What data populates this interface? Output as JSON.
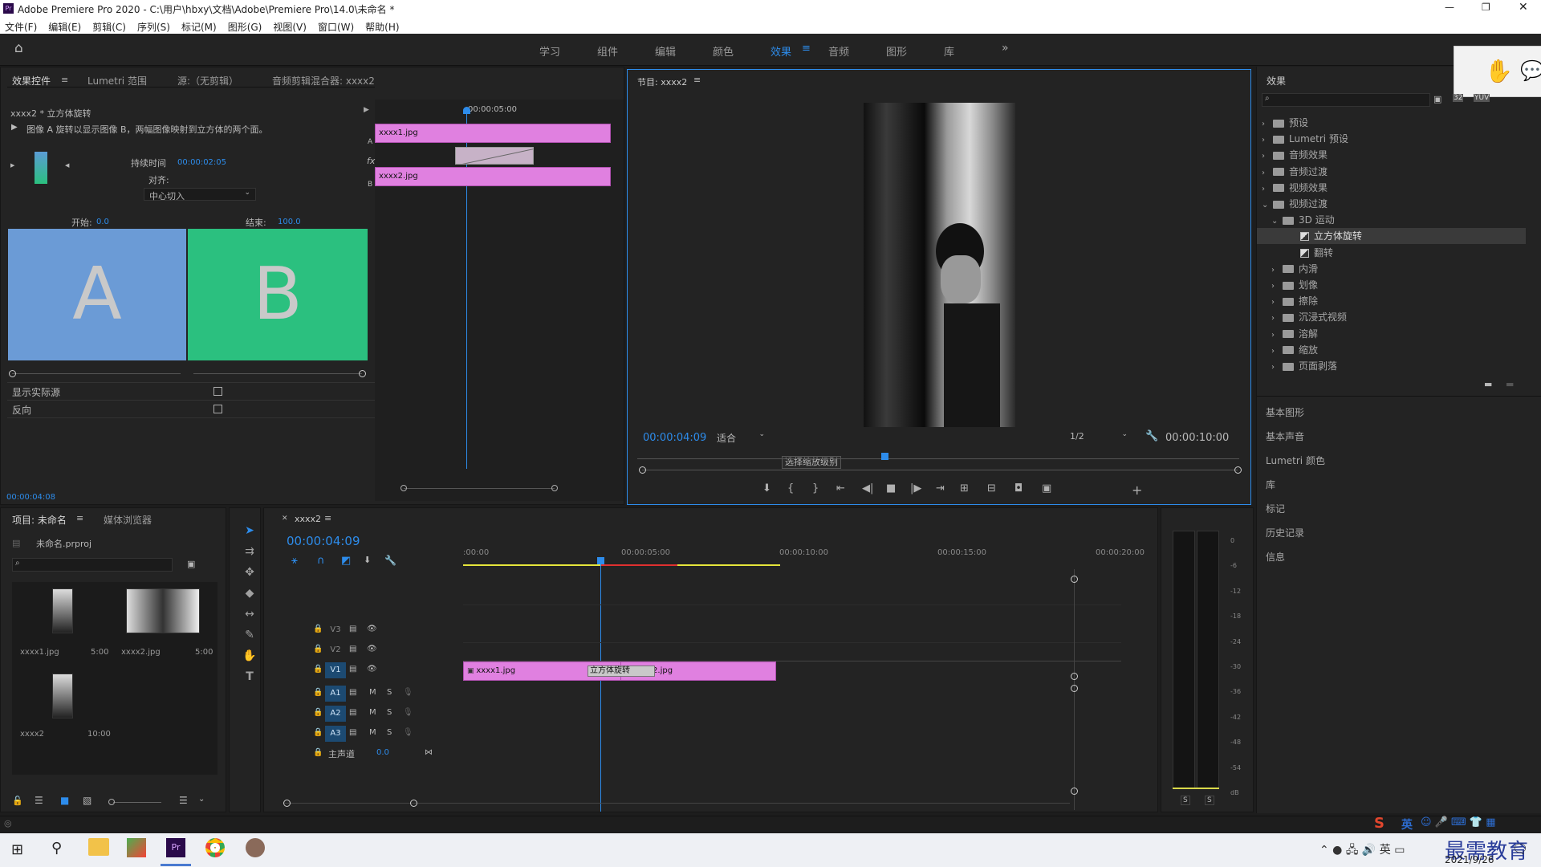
{
  "window": {
    "title": "Adobe Premiere Pro 2020 - C:\\用户\\hbxy\\文档\\Adobe\\Premiere Pro\\14.0\\未命名 *"
  },
  "menu": [
    "文件(F)",
    "编辑(E)",
    "剪辑(C)",
    "序列(S)",
    "标记(M)",
    "图形(G)",
    "视图(V)",
    "窗口(W)",
    "帮助(H)"
  ],
  "workspaces": [
    "学习",
    "组件",
    "编辑",
    "颜色",
    "效果",
    "音频",
    "图形",
    "库"
  ],
  "effect_controls": {
    "tabs": [
      "效果控件",
      "Lumetri 范围",
      "源:（无剪辑）",
      "音频剪辑混合器: xxxx2"
    ],
    "clip_name": "xxxx2 * 立方体旋转",
    "description": "图像 A 旋转以显示图像 B，两幅图像映射到立方体的两个面。",
    "duration_label": "持续时间",
    "duration_value": "00:00:02:05",
    "align_label": "对齐:",
    "align_value": "中心切入",
    "start_label": "开始:",
    "start_value": "0.0",
    "end_label": "结束:",
    "end_value": "100.0",
    "a_label": "A",
    "b_label": "B",
    "show_actual_label": "显示实际源",
    "reverse_label": "反向",
    "timecode": "00:00:04:08",
    "mini_timeline_time": "00:00:05:00",
    "clip_a": "xxxx1.jpg",
    "clip_b": "xxxx2.jpg",
    "track_a": "A",
    "track_b": "B",
    "fx": "fx"
  },
  "program": {
    "title": "节目: xxxx2",
    "timecode": "00:00:04:09",
    "fit": "适合",
    "quality": "1/2",
    "duration": "00:00:10:00",
    "tooltip": "选择缩放级别",
    "playhead_fraction": 0.41
  },
  "effects_panel": {
    "title": "效果",
    "tree": [
      {
        "label": "预设",
        "indent": 0,
        "type": "folder"
      },
      {
        "label": "Lumetri 预设",
        "indent": 0,
        "type": "folder"
      },
      {
        "label": "音频效果",
        "indent": 0,
        "type": "folder"
      },
      {
        "label": "音频过渡",
        "indent": 0,
        "type": "folder"
      },
      {
        "label": "视频效果",
        "indent": 0,
        "type": "folder"
      },
      {
        "label": "视频过渡",
        "indent": 0,
        "type": "folder-open"
      },
      {
        "label": "3D 运动",
        "indent": 1,
        "type": "folder-open"
      },
      {
        "label": "立方体旋转",
        "indent": 2,
        "type": "item",
        "selected": true
      },
      {
        "label": "翻转",
        "indent": 2,
        "type": "item"
      },
      {
        "label": "内滑",
        "indent": 1,
        "type": "folder"
      },
      {
        "label": "划像",
        "indent": 1,
        "type": "folder"
      },
      {
        "label": "擦除",
        "indent": 1,
        "type": "folder"
      },
      {
        "label": "沉浸式视频",
        "indent": 1,
        "type": "folder"
      },
      {
        "label": "溶解",
        "indent": 1,
        "type": "folder"
      },
      {
        "label": "缩放",
        "indent": 1,
        "type": "folder"
      },
      {
        "label": "页面剥落",
        "indent": 1,
        "type": "folder"
      }
    ],
    "collapsed_panels": [
      "基本图形",
      "基本声音",
      "Lumetri 颜色",
      "库",
      "标记",
      "历史记录",
      "信息"
    ]
  },
  "project": {
    "tabs": [
      "项目: 未命名",
      "媒体浏览器"
    ],
    "file": "未命名.prproj",
    "items": [
      {
        "name": "xxxx1.jpg",
        "duration": "5:00"
      },
      {
        "name": "xxxx2.jpg",
        "duration": "5:00"
      },
      {
        "name": "xxxx2",
        "duration": "10:00"
      }
    ]
  },
  "timeline": {
    "sequence": "xxxx2",
    "timecode": "00:00:04:09",
    "ruler": [
      ":00:00",
      "00:00:05:00",
      "00:00:10:00",
      "00:00:15:00",
      "00:00:20:00"
    ],
    "video_tracks": [
      "V3",
      "V2",
      "V1"
    ],
    "audio_tracks": [
      "A1",
      "A2",
      "A3"
    ],
    "master_label": "主声道",
    "master_value": "0.0",
    "clip1": "xxxx1.jpg",
    "clip2": "xxxx2.jpg",
    "transition": "立方体旋转",
    "m": "M",
    "s": "S"
  },
  "meters": {
    "scale": [
      "0",
      "-6",
      "-12",
      "-18",
      "-24",
      "-30",
      "-36",
      "-42",
      "-48",
      "-54",
      "dB"
    ],
    "s1": "S",
    "s2": "S"
  },
  "taskbar": {
    "date": "2021/9/26",
    "ime": "英",
    "watermark": "最需教育"
  },
  "colors": {
    "accent": "#2d8ceb",
    "clip": "#e080e0",
    "a_swatch": "#6b9bd6",
    "b_swatch": "#2bc07f"
  }
}
